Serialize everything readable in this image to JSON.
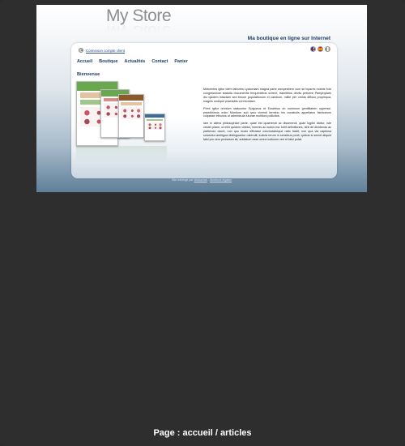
{
  "site": {
    "logo_text": "My Store",
    "tagline": "Ma boutique en ligne sur Internet",
    "login_link": "Connexion compte client",
    "flags": [
      "flag-uk-icon",
      "flag-es-icon",
      "flag-ie-icon"
    ],
    "menu": [
      {
        "label": "Accueil"
      },
      {
        "label": "Boutique"
      },
      {
        "label": "Actualités"
      },
      {
        "label": "Contact"
      },
      {
        "label": "Panier"
      }
    ],
    "section_title": "Bienvenue",
    "paragraphs": [
      "Metuentes igitur idem latrones Lycaoniam magna parte campestrem cum se inpares nostris fore congressione stataria documentis frequentibus scirent, tramitibus deviis petivere Pamphyliam diu quidem intactam sed timore populationum et caedium, milite per omnia diffuso propinqua, magnis undique praesidiis conmunitam.",
      "Primi igitur omnium statuuntur Epigonus et Eusebius ob nominum gentilitatem oppressi. praediximus enim Montium sub ipso vivendi termino his vocabulis appellatos fabricarum culpasse tribunos ut adminicula futurae molitioni pollicitos.",
      "Iam in altera philosophiae parte. quae est quaerendi ac disserendi, quae logikh dicitur, iste vester plane, ut mihi quidem videtur, inermis ac nudus est. tollit definitiones, nihil de dividendo ac partiendo docet, non quo modo efficiatur concludaturque ratio tradit, non qua via captiosa solvantur ambigua distinguantur ostendit; iudicia rerum in sensibus ponit, quibus si semel aliquid falsi pro vero probatum sit, sublatum esse omne iudicium veri et falsi putat."
    ],
    "footer_prefix": "Site hébergé par",
    "footer_link1": "Webachat",
    "footer_sep": " - ",
    "footer_link2": "Mentions légales"
  },
  "caption": "Page : accueil / articles",
  "colors": {
    "background": "#2e2e2e",
    "nav_text": "#1e3d66",
    "gradient_bottom": "#5f7f99"
  }
}
